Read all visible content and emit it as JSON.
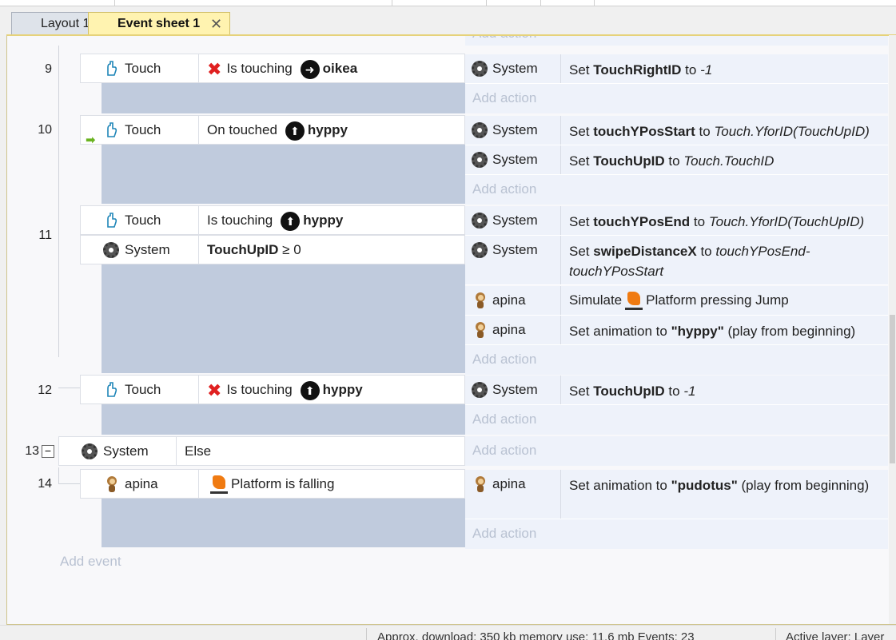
{
  "tabs": [
    {
      "label": "Layout 1"
    },
    {
      "label": "Event sheet 1",
      "close": "✕"
    }
  ],
  "events": {
    "top_add_action": "Add action",
    "e9": {
      "num": "9",
      "cond_obj": "Touch",
      "cond_text": "Is touching",
      "cond_target": "oikea",
      "act_obj": "System",
      "act_pre": "Set",
      "act_var": "TouchRightID",
      "act_mid": "to",
      "act_val": "-1",
      "add": "Add action"
    },
    "e10": {
      "num": "10",
      "cond_obj": "Touch",
      "cond_text": "On touched",
      "cond_target": "hyppy",
      "a1_obj": "System",
      "a1_pre": "Set",
      "a1_var": "touchYPosStart",
      "a1_mid": "to",
      "a1_val": "Touch.YforID(TouchUpID)",
      "a2_obj": "System",
      "a2_pre": "Set",
      "a2_var": "TouchUpID",
      "a2_mid": "to",
      "a2_val": "Touch.TouchID",
      "add": "Add action"
    },
    "e11": {
      "num": "11",
      "c1_obj": "Touch",
      "c1_text": "Is touching",
      "c1_target": "hyppy",
      "c2_obj": "System",
      "c2_var": "TouchUpID",
      "c2_rest": "≥ 0",
      "a1_obj": "System",
      "a1_pre": "Set",
      "a1_var": "touchYPosEnd",
      "a1_mid": "to",
      "a1_val": "Touch.YforID(TouchUpID)",
      "a2_obj": "System",
      "a2_pre": "Set",
      "a2_var": "swipeDistanceX",
      "a2_mid": "to",
      "a2_val": "touchYPosEnd-touchYPosStart",
      "a3_obj": "apina",
      "a3_pre": "Simulate",
      "a3_rest": "Platform pressing Jump",
      "a4_obj": "apina",
      "a4_pre": "Set animation to",
      "a4_val": "\"hyppy\"",
      "a4_rest": "(play from beginning)",
      "add": "Add action"
    },
    "e12": {
      "num": "12",
      "cond_obj": "Touch",
      "cond_text": "Is touching",
      "cond_target": "hyppy",
      "act_obj": "System",
      "act_pre": "Set",
      "act_var": "TouchUpID",
      "act_mid": "to",
      "act_val": "-1",
      "add": "Add action"
    },
    "e13": {
      "num": "13",
      "collapse": "−",
      "cond_obj": "System",
      "cond_text": "Else",
      "add": "Add action"
    },
    "e14": {
      "num": "14",
      "cond_obj": "apina",
      "cond_text": "Platform is falling",
      "act_obj": "apina",
      "act_pre": "Set animation to",
      "act_val": "\"pudotus\"",
      "act_rest": "(play from beginning)",
      "add": "Add action"
    },
    "add_event": "Add event"
  },
  "status": {
    "left": "Approx. download: 350 kb  memory use: 11.6 mb  Events: 23",
    "right": "Active layer: Layer"
  },
  "colors": {
    "accent_tab": "#fff3b0",
    "action_bg": "#eef2fa",
    "condition_block": "#c0cbdd"
  }
}
